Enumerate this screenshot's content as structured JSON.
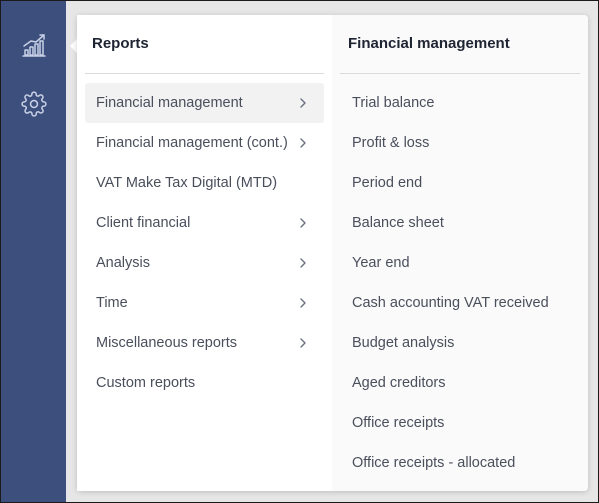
{
  "sidebar": {
    "icons": [
      {
        "name": "reports-chart-icon"
      },
      {
        "name": "gear-icon"
      }
    ]
  },
  "reports_menu": {
    "title": "Reports",
    "items": [
      {
        "label": "Financial management",
        "has_submenu": true,
        "active": true
      },
      {
        "label": "Financial management (cont.)",
        "has_submenu": true,
        "active": false
      },
      {
        "label": "VAT Make Tax Digital (MTD)",
        "has_submenu": false,
        "active": false
      },
      {
        "label": "Client financial",
        "has_submenu": true,
        "active": false
      },
      {
        "label": "Analysis",
        "has_submenu": true,
        "active": false
      },
      {
        "label": "Time",
        "has_submenu": true,
        "active": false
      },
      {
        "label": "Miscellaneous reports",
        "has_submenu": true,
        "active": false
      },
      {
        "label": "Custom reports",
        "has_submenu": false,
        "active": false
      }
    ]
  },
  "submenu": {
    "title": "Financial management",
    "items": [
      {
        "label": "Trial balance"
      },
      {
        "label": "Profit & loss"
      },
      {
        "label": "Period end"
      },
      {
        "label": "Balance sheet"
      },
      {
        "label": "Year end"
      },
      {
        "label": "Cash accounting VAT received"
      },
      {
        "label": "Budget analysis"
      },
      {
        "label": "Aged creditors"
      },
      {
        "label": "Office receipts"
      },
      {
        "label": "Office receipts - allocated"
      }
    ]
  },
  "colors": {
    "sidebar": "#3d4f7c",
    "icon": "#c8d0e6",
    "text": "#4a4f5c",
    "title": "#1f2433",
    "active_bg": "#f2f2f3"
  }
}
